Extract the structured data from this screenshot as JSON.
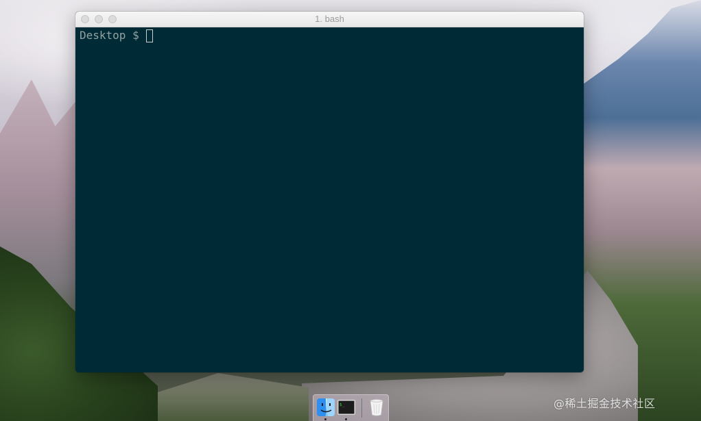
{
  "window": {
    "title": "1. bash"
  },
  "terminal": {
    "prompt": "Desktop $",
    "background_color": "#002b36",
    "text_color": "#93a1a1"
  },
  "dock": {
    "items": [
      {
        "icon": "finder-icon",
        "running": true
      },
      {
        "icon": "terminal-icon",
        "label": "$_",
        "running": true
      },
      {
        "icon": "trash-icon",
        "running": false
      }
    ]
  },
  "watermark": {
    "text": "@稀土掘金技术社区"
  }
}
